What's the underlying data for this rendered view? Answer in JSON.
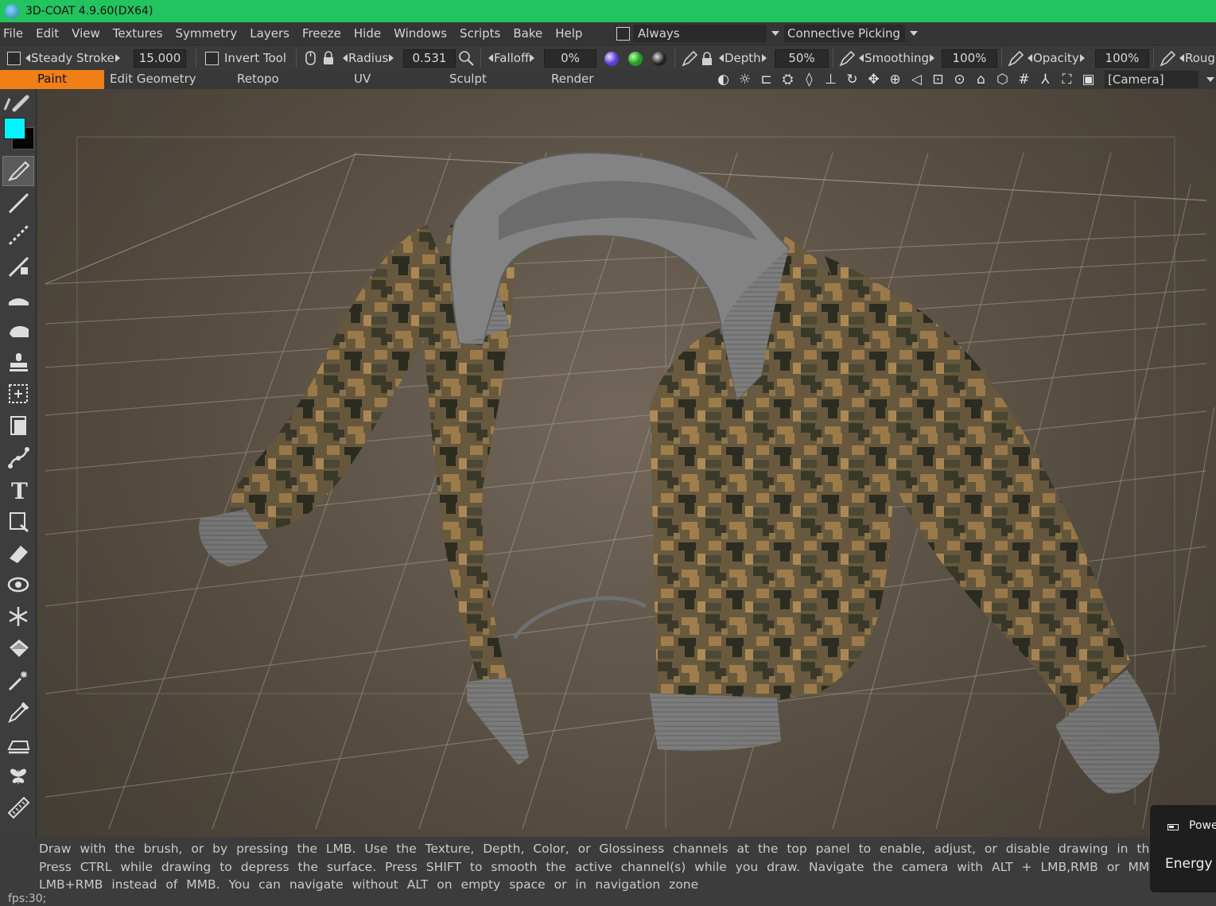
{
  "window": {
    "title": "3D-COAT 4.9.60(DX64)"
  },
  "menu": [
    "File",
    "Edit",
    "View",
    "Textures",
    "Symmetry",
    "Layers",
    "Freeze",
    "Hide",
    "Windows",
    "Scripts",
    "Bake",
    "Help"
  ],
  "picking": {
    "always_label": "Always",
    "always_checked": false,
    "mode": "Connective  Picking"
  },
  "toolbar": {
    "steady_stroke_label": "Steady  Stroke",
    "steady_stroke_value": "15.000",
    "invert_tool_label": "Invert  Tool",
    "radius_label": "Radius",
    "radius_value": "0.531",
    "falloff_label": "Falloff",
    "falloff_value": "0%",
    "depth_label": "Depth",
    "depth_value": "50%",
    "smoothing_label": "Smoothing",
    "smoothing_value": "100%",
    "opacity_label": "Opacity",
    "opacity_value": "100%",
    "roughness_label": "Roug"
  },
  "rooms": [
    "Paint",
    "Edit  Geometry",
    "Retopo",
    "UV",
    "Sculpt",
    "Render"
  ],
  "active_room": "Paint",
  "camera": {
    "label": "[Camera]"
  },
  "colors": {
    "primary": "#00f6ff",
    "secondary": "#050505",
    "accent": "#f07f17",
    "titlebar": "#21c45f"
  },
  "tools": [
    "brush-icon",
    "line-icon",
    "smudge-icon",
    "blend-icon",
    "flatten-icon",
    "fill-icon",
    "stamp-icon",
    "select-rect-icon",
    "layer-copy-icon",
    "spline-icon",
    "text-icon",
    "crop-icon",
    "eraser-icon",
    "eye-icon",
    "snowflake-icon",
    "bucket-icon",
    "magic-wand-icon",
    "eyedropper-icon",
    "iron-icon",
    "butterfly-icon",
    "ruler-icon"
  ],
  "hint_lines": [
    "Draw with the brush, or by pressing the LMB. Use the Texture, Depth, Color, or Glossiness channels at the top panel to enable, adjust, or disable drawing in the various chann",
    "Press CTRL while drawing to depress the surface. Press SHIFT to smooth the active channel(s) while you draw. Navigate the camera with ALT + LMB,RMB or MMB. You can u",
    "LMB+RMB instead of MMB. You can navigate without ALT on empty space or in navigation zone"
  ],
  "status": {
    "fps": "fps:30;"
  },
  "notification": {
    "title": "Powe",
    "body": "Energy s"
  }
}
